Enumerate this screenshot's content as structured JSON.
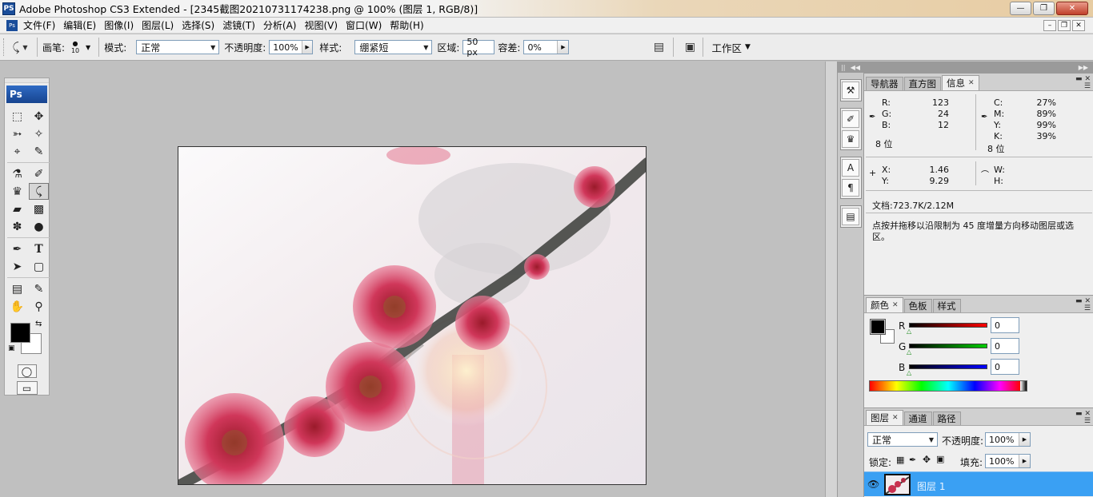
{
  "window": {
    "app_icon": "PS",
    "title": "Adobe Photoshop CS3 Extended - [2345截图20210731174238.png @ 100% (图层 1, RGB/8)]",
    "buttons": [
      "minimize-icon",
      "maximize-icon",
      "close-icon"
    ]
  },
  "menubar": {
    "items": [
      "文件(F)",
      "编辑(E)",
      "图像(I)",
      "图层(L)",
      "选择(S)",
      "滤镜(T)",
      "分析(A)",
      "视图(V)",
      "窗口(W)",
      "帮助(H)"
    ]
  },
  "options": {
    "brush_label": "画笔:",
    "brush_size": "10",
    "mode_label": "模式:",
    "mode_value": "正常",
    "opacity_label": "不透明度:",
    "opacity_value": "100%",
    "style_label": "样式:",
    "style_value": "绷紧短",
    "area_label": "区域:",
    "area_value": "50 px",
    "tolerance_label": "容差:",
    "tolerance_value": "0%",
    "workspace_label": "工作区"
  },
  "toolbox": {
    "header": "Ps",
    "fg_color": "#000000",
    "bg_color": "#ffffff"
  },
  "info_panel": {
    "tabs": [
      "导航器",
      "直方图",
      "信息"
    ],
    "active_tab": "信息",
    "rgb": {
      "R_label": "R:",
      "R": "123",
      "G_label": "G:",
      "G": "24",
      "B_label": "B:",
      "B": "12"
    },
    "cmyk": {
      "C_label": "C:",
      "C": "27%",
      "M_label": "M:",
      "M": "89%",
      "Y_label": "Y:",
      "Y": "99%",
      "K_label": "K:",
      "K": "39%"
    },
    "bits_left": "8 位",
    "bits_right": "8 位",
    "x_label": "X:",
    "x": "1.46",
    "y_label": "Y:",
    "y": "9.29",
    "w_label": "W:",
    "h_label": "H:",
    "doc": "文档:723.7K/2.12M",
    "hint": "点按并拖移以沿限制为 45 度增量方向移动图层或选区。"
  },
  "color_panel": {
    "tabs": [
      "颜色",
      "色板",
      "样式"
    ],
    "active_tab": "颜色",
    "r_label": "R",
    "r_value": "0",
    "g_label": "G",
    "g_value": "0",
    "b_label": "B",
    "b_value": "0",
    "fg": "#000000",
    "bg": "#ffffff"
  },
  "layers_panel": {
    "tabs": [
      "图层",
      "通道",
      "路径"
    ],
    "active_tab": "图层",
    "blend_mode": "正常",
    "opacity_label": "不透明度:",
    "opacity_value": "100%",
    "lock_label": "锁定:",
    "fill_label": "填充:",
    "fill_value": "100%",
    "layer_name": "图层 1"
  },
  "colors": {
    "accent_blue": "#3aa0f3",
    "title_ps_blue": "#1a4d9a"
  }
}
